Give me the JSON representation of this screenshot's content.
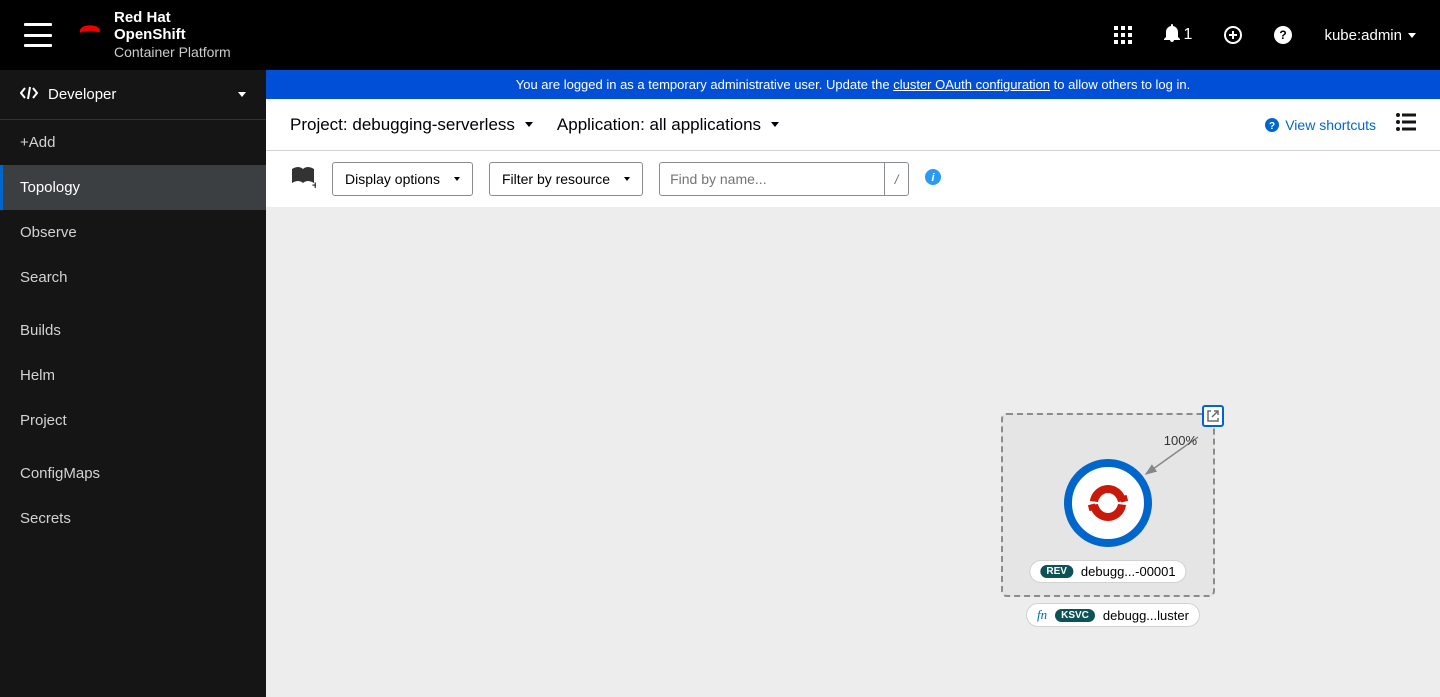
{
  "brand": {
    "line1": "Red Hat",
    "line2": "OpenShift",
    "line3": "Container Platform"
  },
  "header": {
    "notif_count": "1",
    "user": "kube:admin"
  },
  "perspective": {
    "label": "Developer"
  },
  "nav": {
    "add": "+Add",
    "topology": "Topology",
    "observe": "Observe",
    "search": "Search",
    "builds": "Builds",
    "helm": "Helm",
    "project": "Project",
    "configmaps": "ConfigMaps",
    "secrets": "Secrets"
  },
  "banner": {
    "pre": "You are logged in as a temporary administrative user. Update the ",
    "link": "cluster OAuth configuration",
    "post": " to allow others to log in."
  },
  "toolbar1": {
    "project_prefix": "Project: ",
    "project_value": "debugging-serverless",
    "app_prefix": "Application: ",
    "app_value": "all applications",
    "shortcuts": "View shortcuts"
  },
  "toolbar2": {
    "display": "Display options",
    "filter": "Filter by resource",
    "search_placeholder": "Find by name...",
    "search_key": "/"
  },
  "topology": {
    "traffic": "100%",
    "rev_badge": "REV",
    "rev_name": "debugg...-00001",
    "ksvc_badge": "KSVC",
    "ksvc_name": "debugg...luster"
  }
}
